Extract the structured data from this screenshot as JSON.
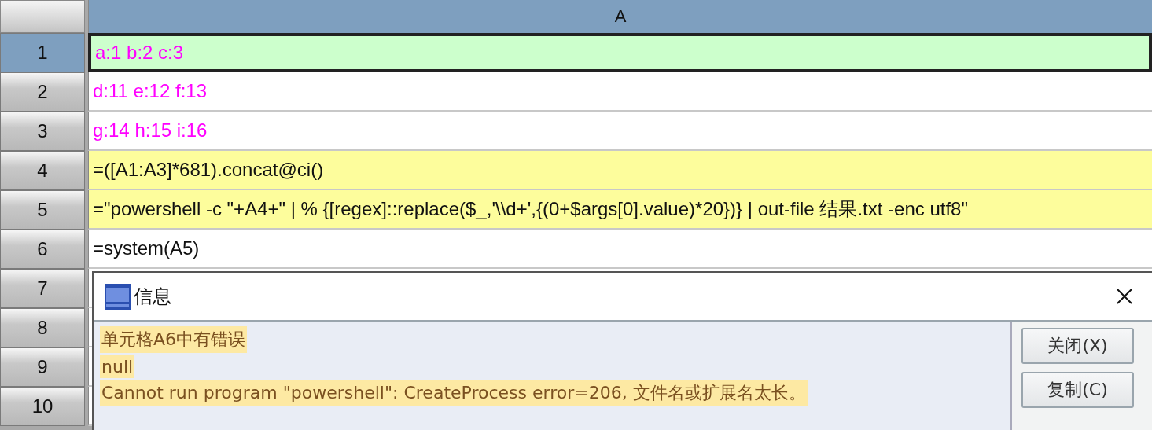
{
  "column_header": "A",
  "rows": [
    {
      "number": "1",
      "selected": true,
      "cell": {
        "text": "a:1 b:2 c:3",
        "kind": "constant",
        "highlighted": false
      }
    },
    {
      "number": "2",
      "selected": false,
      "cell": {
        "text": "d:11 e:12 f:13",
        "kind": "constant",
        "highlighted": false
      }
    },
    {
      "number": "3",
      "selected": false,
      "cell": {
        "text": "g:14 h:15 i:16",
        "kind": "constant",
        "highlighted": false
      }
    },
    {
      "number": "4",
      "selected": false,
      "cell": {
        "text": "=([A1:A3]*681).concat@ci()",
        "kind": "formula",
        "highlighted": true
      }
    },
    {
      "number": "5",
      "selected": false,
      "cell": {
        "text": "=\"powershell -c \"+A4+\" | % {[regex]::replace($_,'\\\\d+',{(0+$args[0].value)*20})} | out-file 结果.txt -enc utf8\"",
        "kind": "formula",
        "highlighted": true
      }
    },
    {
      "number": "6",
      "selected": false,
      "cell": {
        "text": "=system(A5)",
        "kind": "formula",
        "highlighted": false
      }
    },
    {
      "number": "7",
      "selected": false
    },
    {
      "number": "8",
      "selected": false
    },
    {
      "number": "9",
      "selected": false
    },
    {
      "number": "10",
      "selected": false
    }
  ],
  "dialog": {
    "title": "信息",
    "messages": [
      "单元格A6中有错误",
      "null",
      "Cannot run program \"powershell\": CreateProcess error=206, 文件名或扩展名太长。"
    ],
    "buttons": [
      "关闭(X)",
      "复制(C)"
    ]
  }
}
